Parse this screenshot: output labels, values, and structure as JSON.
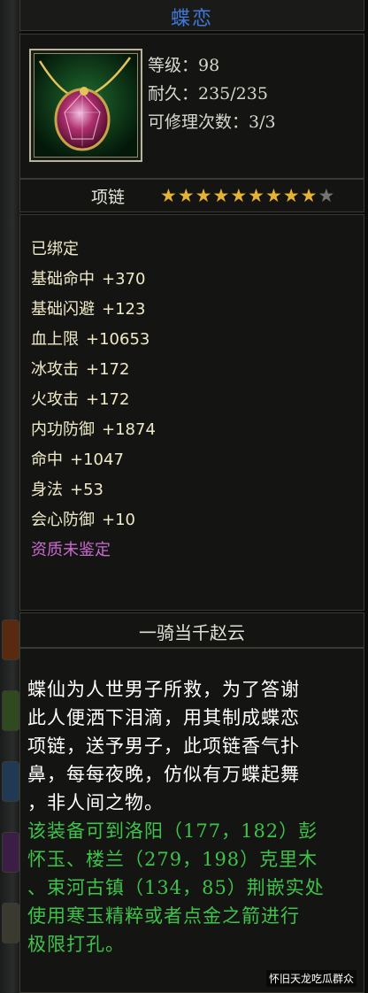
{
  "item": {
    "name": "蝶恋",
    "level": "等级：98",
    "durability": "耐久：235/235",
    "repairs": "可修理次数：3/3",
    "type": "项链",
    "stars_total": 10,
    "stars_lit": 9,
    "icon": "pendant-icon"
  },
  "attributes": {
    "bound": "已绑定",
    "list": [
      {
        "name": "基础命中",
        "value": "+370"
      },
      {
        "name": "基础闪避",
        "value": "+123"
      },
      {
        "name": "血上限",
        "value": "+10653"
      },
      {
        "name": "冰攻击",
        "value": "+172"
      },
      {
        "name": "火攻击",
        "value": "+172"
      },
      {
        "name": "内功防御",
        "value": "+1874"
      },
      {
        "name": "命中",
        "value": "+1047"
      },
      {
        "name": "身法",
        "value": "+53"
      },
      {
        "name": "会心防御",
        "value": "+10"
      }
    ],
    "quality": "资质未鉴定"
  },
  "set_name": "一骑当千赵云",
  "description": {
    "lore": [
      "蝶仙为人世男子所救，为了答谢",
      "此人便洒下泪滴，用其制成蝶恋",
      "项链，送予男子，此项链香气扑",
      "鼻，每每夜晚，仿似有万蝶起舞",
      "，非人间之物。"
    ],
    "hint": [
      "该装备可到洛阳（177，182）彭",
      "怀玉、楼兰（279，198）克里木",
      "、束河古镇（134，85）荆嵌实处",
      "使用寒玉精粹或者点金之箭进行",
      "极限打孔。"
    ]
  },
  "watermark": "怀旧天龙吃瓜群众",
  "colors": {
    "title_blue": "#3f78d8",
    "star_gold": "#e6b233",
    "quality_purple": "#c96ad0",
    "hint_green": "#3ec24a"
  }
}
